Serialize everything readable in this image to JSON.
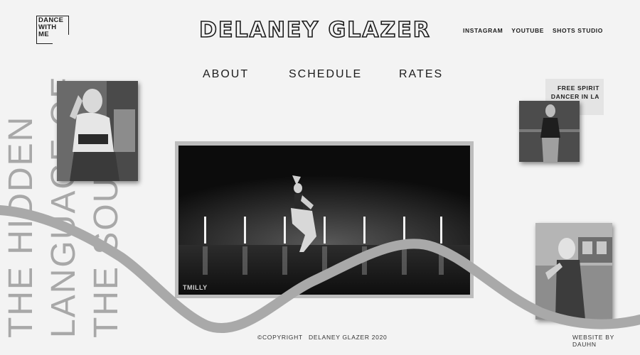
{
  "logo": {
    "lines": [
      "DANCE",
      "WITH",
      "ME"
    ]
  },
  "brand": {
    "name": "DELANEY GLAZER"
  },
  "social": [
    "INSTAGRAM",
    "YOUTUBE",
    "SHOTS STUDIO"
  ],
  "nav": [
    "ABOUT",
    "SCHEDULE",
    "RATES"
  ],
  "tagline": {
    "line1": "FREE SPIRIT",
    "line2": "DANCER IN LA"
  },
  "vertical_text": {
    "line1": "THE HIDDEN",
    "line2": "LANGUAGE OF",
    "line3": "THE SOUL"
  },
  "video": {
    "watermark": "TMILLY"
  },
  "footer": {
    "copyright": "©COPYRIGHT",
    "owner": "DELANEY GLAZER 2020",
    "credit": "WEBSITE BY DAUHN"
  },
  "colors": {
    "background": "#f3f3f3",
    "text": "#1c1c1c",
    "wave": "#a9a9a9",
    "accent_gray": "#bdbdbd"
  }
}
